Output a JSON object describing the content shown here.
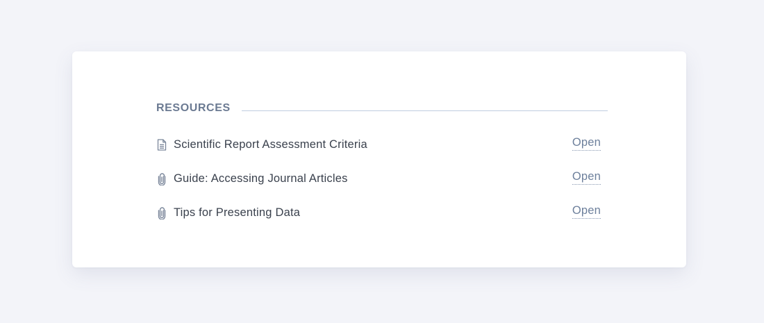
{
  "resources": {
    "heading": "RESOURCES",
    "items": [
      {
        "title": "Scientific Report Assessment Criteria",
        "icon": "document-icon",
        "action": "Open"
      },
      {
        "title": "Guide: Accessing Journal Articles",
        "icon": "paperclip-icon",
        "action": "Open"
      },
      {
        "title": "Tips for Presenting Data",
        "icon": "paperclip-icon",
        "action": "Open"
      }
    ]
  },
  "colors": {
    "background": "#f3f4f9",
    "card": "#ffffff",
    "heading": "#6b7a92",
    "rule": "#bfcde0",
    "text": "#3a414d",
    "link": "#6c7f9b",
    "icon": "#7a869a"
  }
}
